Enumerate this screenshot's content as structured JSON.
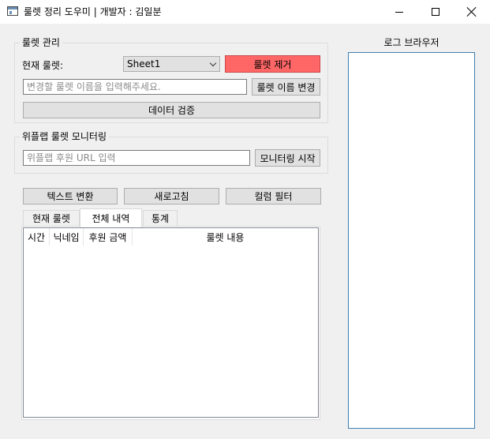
{
  "window": {
    "title": "룰렛 정리 도우미 | 개발자 : 김일분"
  },
  "roulette_group": {
    "legend": "룰렛 관리",
    "current_label": "현재 룰렛:",
    "sheet_selected": "Sheet1",
    "remove_button": "룰렛 제거",
    "rename_placeholder": "변경할 룰렛 이름을 입력해주세요.",
    "rename_button": "룰렛 이름 변경",
    "validate_button": "데이터 검증"
  },
  "monitor_group": {
    "legend": "위플랩 룰렛 모니터링",
    "url_placeholder": "위플랩 후원 URL 입력",
    "start_button": "모니터링 시작"
  },
  "actions": {
    "text_convert": "텍스트 변환",
    "refresh": "새로고침",
    "column_filter": "컬럼 필터"
  },
  "tabs": [
    {
      "label": "현재 룰렛",
      "active": false
    },
    {
      "label": "전체 내역",
      "active": true
    },
    {
      "label": "통계",
      "active": false
    }
  ],
  "table": {
    "columns": [
      "시간",
      "닉네임",
      "후원 금액",
      "룰렛 내용"
    ],
    "rows": []
  },
  "log": {
    "title": "로그 브라우저"
  },
  "colors": {
    "remove_button_bg": "#ff6666",
    "log_border": "#3c7fb1",
    "window_bg": "#f0f0f0"
  }
}
